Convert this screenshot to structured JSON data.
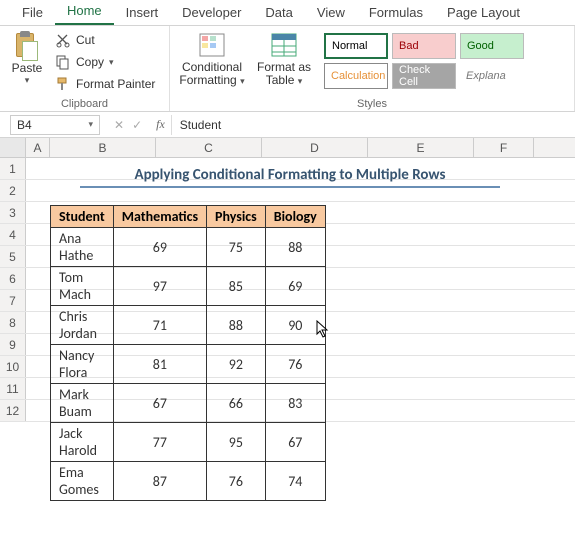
{
  "tabs": [
    "File",
    "Home",
    "Insert",
    "Developer",
    "Data",
    "View",
    "Formulas",
    "Page Layout"
  ],
  "active_tab_index": 1,
  "clipboard": {
    "paste": "Paste",
    "cut": "Cut",
    "copy": "Copy",
    "fmt": "Format Painter",
    "group_label": "Clipboard"
  },
  "styles": {
    "cond_fmt": "Conditional Formatting",
    "fmt_table": "Format as Table",
    "normal": "Normal",
    "bad": "Bad",
    "good": "Good",
    "calc": "Calculation",
    "check": "Check Cell",
    "explan": "Explana",
    "group_label": "Styles"
  },
  "namebox": "B4",
  "formula_value": "Student",
  "columns": [
    "A",
    "B",
    "C",
    "D",
    "E",
    "F"
  ],
  "row_headers": [
    "1",
    "2",
    "3",
    "4",
    "5",
    "6",
    "7",
    "8",
    "9",
    "10",
    "11",
    "12"
  ],
  "sheet_title": "Applying Conditional Formatting to Multiple Rows",
  "headers": [
    "Student",
    "Mathematics",
    "Physics",
    "Biology"
  ],
  "rows": [
    {
      "name": "Ana Hathe",
      "math": 69,
      "phys": 75,
      "bio": 88
    },
    {
      "name": "Tom Mach",
      "math": 97,
      "phys": 85,
      "bio": 69
    },
    {
      "name": "Chris Jordan",
      "math": 71,
      "phys": 88,
      "bio": 90
    },
    {
      "name": "Nancy Flora",
      "math": 81,
      "phys": 92,
      "bio": 76
    },
    {
      "name": "Mark Buam",
      "math": 67,
      "phys": 66,
      "bio": 83
    },
    {
      "name": "Jack Harold",
      "math": 77,
      "phys": 95,
      "bio": 67
    },
    {
      "name": "Ema Gomes",
      "math": 87,
      "phys": 76,
      "bio": 74
    }
  ]
}
